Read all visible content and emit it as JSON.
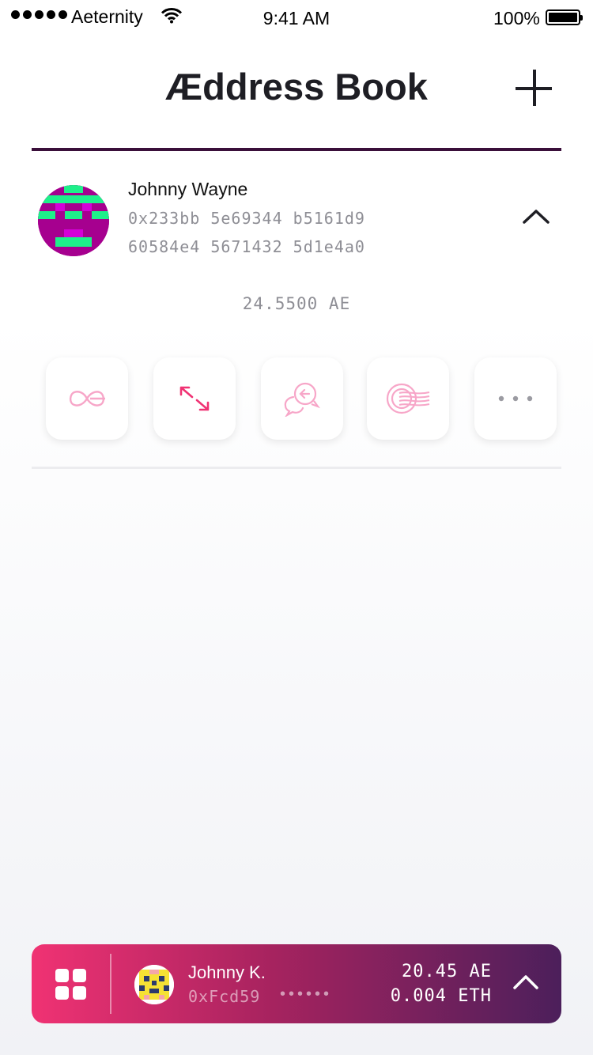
{
  "status_bar": {
    "carrier": "Aeternity",
    "time": "9:41 AM",
    "battery": "100%"
  },
  "header": {
    "title": "Æddress Book",
    "add_icon": "plus-icon"
  },
  "contact": {
    "name": "Johnny Wayne",
    "address_line1": "0x233bb 5e69344 b5161d9",
    "address_line2": "60584e4 5671432 5d1e4a0",
    "balance": "24.5500 AE",
    "expand_icon": "chevron-up-icon",
    "actions": [
      {
        "icon": "aeternity-logo-icon"
      },
      {
        "icon": "transfer-arrows-icon"
      },
      {
        "icon": "chat-bubbles-icon"
      },
      {
        "icon": "stamp-icon"
      },
      {
        "icon": "more-icon"
      }
    ]
  },
  "account_bar": {
    "name": "Johnny K.",
    "address": "0xFcd59",
    "address_mask": "••••••",
    "balance_ae": "20.45 AE",
    "balance_eth": "0.004 ETH",
    "menu_icon": "grid-icon",
    "expand_icon": "chevron-up-icon"
  },
  "colors": {
    "accent": "#f03273",
    "dark": "#3a0f3a",
    "icon_pink": "#f7a6c8"
  }
}
